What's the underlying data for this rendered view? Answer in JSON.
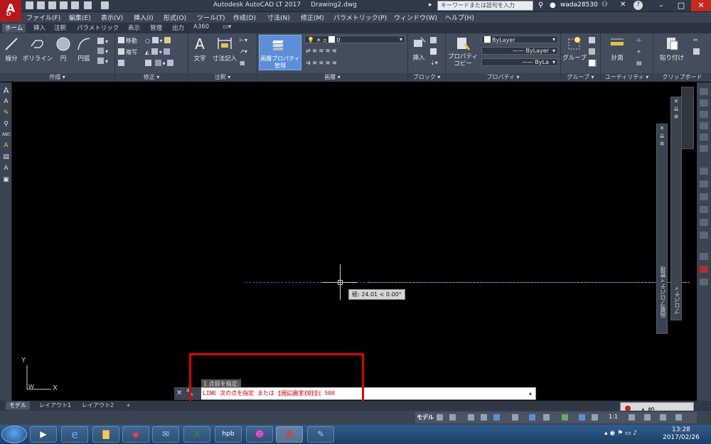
{
  "window": {
    "app_logo": "A",
    "app_logo_sub": "LT",
    "title": "Autodesk AutoCAD LT 2017",
    "document": "Drawing2.dwg",
    "search_placeholder": "キーワードまたは語句を入力",
    "username": "wada28530",
    "help_label": "?",
    "min_label": "–",
    "max_label": "□",
    "close_label": "✕"
  },
  "menubar": [
    "ファイル(F)",
    "編集(E)",
    "表示(V)",
    "挿入(I)",
    "形式(O)",
    "ツール(T)",
    "作成(D)",
    "寸法(N)",
    "修正(M)",
    "パラメトリック(P)",
    "ウィンドウ(W)",
    "ヘルプ(H)"
  ],
  "ribbon_tabs": [
    "ホーム",
    "挿入",
    "注釈",
    "パラメトリック",
    "表示",
    "管理",
    "出力",
    "A360"
  ],
  "ribbon": {
    "draw": {
      "title": "作成 ▾",
      "line": "線分",
      "polyline": "ポリライン",
      "circle": "円",
      "arc": "円弧"
    },
    "modify": {
      "title": "修正 ▾",
      "move": "移動",
      "copy": "複写"
    },
    "annotation": {
      "title": "注釈 ▾",
      "text": "文字",
      "dimension": "寸法記入"
    },
    "layers": {
      "title": "画層 ▾",
      "layer_props": "画層プロパティ",
      "layer_props2": "管理",
      "current_layer": "0"
    },
    "block": {
      "title": "ブロック ▾",
      "insert": "挿入"
    },
    "properties": {
      "title": "プロパティ ▾",
      "match": "プロパティ",
      "match2": "コピー",
      "color": "ByLayer",
      "linetype": "ByLayer",
      "lineweight": "ByLa"
    },
    "groups": {
      "title": "グループ ▾",
      "group": "グループ"
    },
    "utilities": {
      "title": "ユーティリティ ▾",
      "measure": "計測"
    },
    "clipboard": {
      "title": "クリップボード",
      "paste": "貼り付け"
    }
  },
  "canvas": {
    "tooltip": "極: 24.01 < 0.00°",
    "ucs_y": "Y",
    "ucs_x": "X",
    "ucs_w": "W"
  },
  "palettes": {
    "layer_props_palette": "画層プロパティ管理",
    "properties_palette": "プロパティ"
  },
  "command": {
    "history": "1 点目を指定:",
    "prompt_prefix": "LINE 次の点を指定 または",
    "option": "[元に戻す(U)]:",
    "input": "500"
  },
  "layout_tabs": [
    "モデル",
    "レイアウト1",
    "レイアウト2",
    "+"
  ],
  "status": {
    "model": "モデル",
    "scale": "1:1"
  },
  "ime": {
    "mode": "A 般"
  },
  "taskbar": {
    "time": "13:28",
    "date": "2017/02/26"
  },
  "colors": {
    "accent_red": "#b8181a",
    "highlight_box": "#e00000",
    "ribbon": "#434d5b"
  }
}
